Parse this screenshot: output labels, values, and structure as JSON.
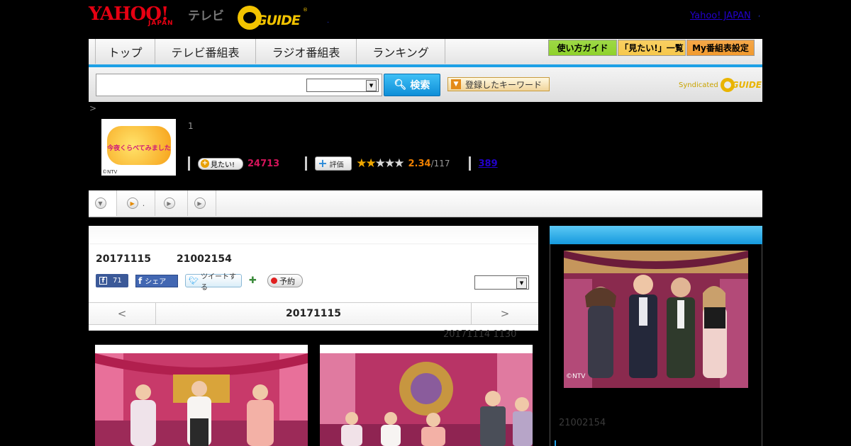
{
  "header": {
    "yahoo_logo": "YAHOO!",
    "yahoo_logo_sub": "JAPAN",
    "tv_label": "テレビ",
    "gguide_logo": "GUIDE",
    "gguide_reg": "®",
    "dot": ".",
    "yahoo_japan_link": "Yahoo! JAPAN",
    "link_sep": ","
  },
  "nav": {
    "tabs": [
      {
        "label": "トップ"
      },
      {
        "label": "テレビ番組表"
      },
      {
        "label": "ラジオ番組表"
      },
      {
        "label": "ランキング"
      }
    ],
    "buttons": [
      {
        "label": "使い方ガイド",
        "bg": "#8fd22b"
      },
      {
        "label": "「見たい!」一覧",
        "bg": "#f7c84b"
      },
      {
        "label": "My番組表設定",
        "bg": "#f29a2e"
      }
    ],
    "accent": "#1ea0e6"
  },
  "search": {
    "button_label": "検索",
    "keyword_button_label": "登録したキーワード",
    "syndicated_label": "Syndicated",
    "syndicated_logo": "GUIDE"
  },
  "breadcrumb": {
    "text": ">"
  },
  "program": {
    "thumb_title": "今夜くらべてみました",
    "thumb_credit": "©NTV",
    "number": "1",
    "mitai_label": "見たい!",
    "mitai_count": "24713",
    "hyoka_label": "評価",
    "rating_filled": 2,
    "rating_max": 5,
    "score": "2.34",
    "score_total": "/117",
    "review_count": "389"
  },
  "subtabs": [
    {
      "label": ""
    },
    {
      "label": "."
    },
    {
      "label": ""
    },
    {
      "label": ""
    }
  ],
  "main": {
    "air_date": "20171115",
    "program_id": "21002154",
    "fb_count": "71",
    "fb_share_label": "シェア",
    "tweet_label": "ツイートする",
    "yoyaku_label": "予約",
    "prev_arrow": "<",
    "next_arrow": ">",
    "nav_date": "20171115",
    "updated": "20171114 1130"
  },
  "side": {
    "credit": "©NTV",
    "program_id": "21002154"
  }
}
